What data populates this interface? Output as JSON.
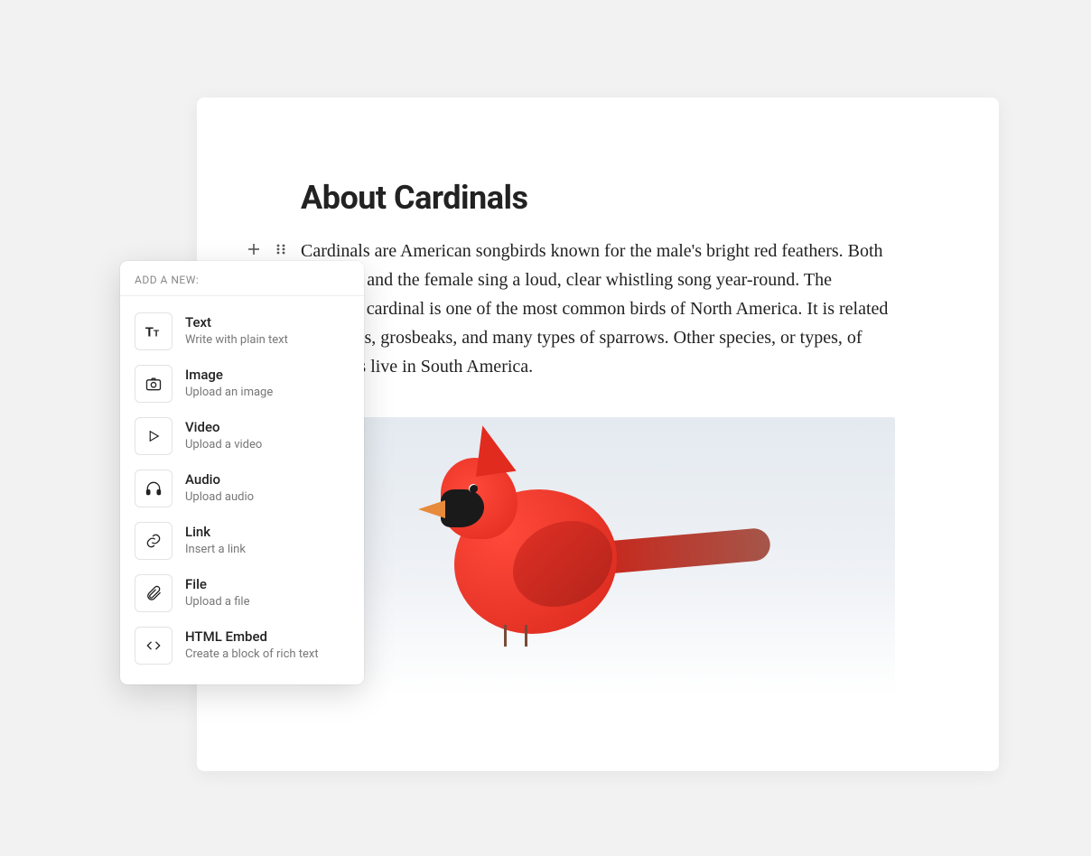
{
  "document": {
    "title": "About Cardinals",
    "paragraph": "Cardinals are American songbirds known for the male's bright red feathers. Both the male and the female sing a loud, clear whistling song year-round. The northern cardinal is one of the most common birds of North America. It is related to finches, grosbeaks, and many types of sparrows. Other species, or types, of cardinals live in South America.",
    "image_alt": "Red northern cardinal standing in snow"
  },
  "add_menu": {
    "header": "ADD A NEW:",
    "items": [
      {
        "icon": "text-icon",
        "title": "Text",
        "desc": "Write with plain text"
      },
      {
        "icon": "camera-icon",
        "title": "Image",
        "desc": "Upload an image"
      },
      {
        "icon": "play-icon",
        "title": "Video",
        "desc": "Upload a video"
      },
      {
        "icon": "headphones-icon",
        "title": "Audio",
        "desc": "Upload audio"
      },
      {
        "icon": "link-icon",
        "title": "Link",
        "desc": "Insert a link"
      },
      {
        "icon": "paperclip-icon",
        "title": "File",
        "desc": "Upload a file"
      },
      {
        "icon": "code-icon",
        "title": "HTML Embed",
        "desc": "Create a block of rich text"
      }
    ]
  }
}
